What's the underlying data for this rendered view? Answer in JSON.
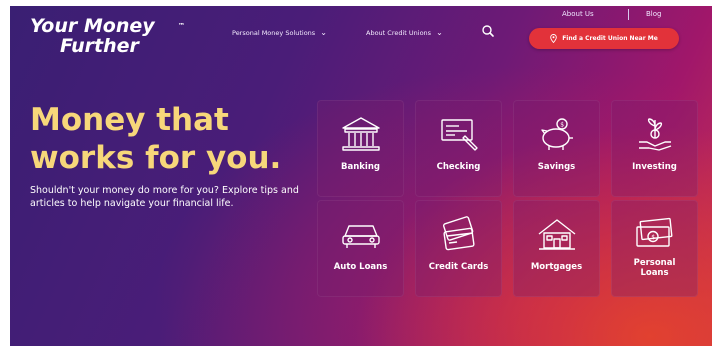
{
  "header": {
    "logo_line1": "Your Money",
    "logo_line2": "Further",
    "logo_tm": "™",
    "utility": {
      "about": "About Us",
      "blog": "Blog"
    },
    "nav": [
      {
        "label": "Personal Money Solutions",
        "icon": "chevron-down-icon"
      },
      {
        "label": "About Credit Unions",
        "icon": "chevron-down-icon"
      }
    ],
    "search_icon": "search-icon",
    "cta": {
      "label": "Find a Credit Union Near Me",
      "icon": "location-pin-icon"
    }
  },
  "hero": {
    "title_line1": "Money that",
    "title_line2": "works for you.",
    "subtitle": "Shouldn't your money do more for you?  Explore tips and articles to help navigate your financial life."
  },
  "tiles": [
    {
      "label": "Banking",
      "icon": "bank-icon"
    },
    {
      "label": "Checking",
      "icon": "check-icon"
    },
    {
      "label": "Savings",
      "icon": "piggy-bank-icon"
    },
    {
      "label": "Investing",
      "icon": "investing-icon"
    },
    {
      "label": "Auto Loans",
      "icon": "car-icon"
    },
    {
      "label": "Credit Cards",
      "icon": "credit-cards-icon"
    },
    {
      "label": "Mortgages",
      "icon": "house-icon"
    },
    {
      "label": "Personal Loans",
      "icon": "cash-icon"
    }
  ],
  "colors": {
    "title_yellow": "#f7d77a",
    "cta_red": "#e2323a",
    "bg_purple": "#3a1f73",
    "bg_magenta": "#a1176a",
    "bg_orange": "#e84628"
  }
}
